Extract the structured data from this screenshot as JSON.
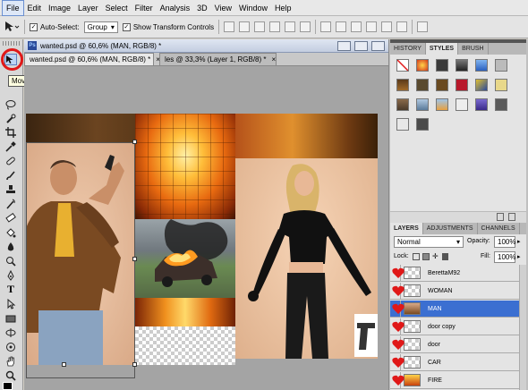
{
  "menu": [
    "File",
    "Edit",
    "Image",
    "Layer",
    "Select",
    "Filter",
    "Analysis",
    "3D",
    "View",
    "Window",
    "Help"
  ],
  "options_bar": {
    "auto_select_label": "Auto-Select:",
    "auto_select_value": "Group",
    "show_transform_label": "Show Transform Controls"
  },
  "document": {
    "window_title": "wanted.psd @ 60,6% (MAN, RGB/8) *",
    "tabs": [
      {
        "label": "wanted.psd @ 60,6% (MAN, RGB/8) *",
        "close": "×",
        "active": true
      },
      {
        "label": "les @ 33,3% (Layer 1, RGB/8) *",
        "close": "×",
        "active": false
      }
    ]
  },
  "tooltip": "Move Tool (V)",
  "style_panel": {
    "tabs": [
      "HISTORY",
      "STYLES",
      "BRUSH"
    ]
  },
  "layers_panel": {
    "tabs": [
      "LAYERS",
      "ADJUSTMENTS",
      "CHANNELS"
    ],
    "blend_mode": "Normal",
    "opacity_label": "Opacity:",
    "opacity_value": "100%",
    "lock_label": "Lock:",
    "fill_label": "Fill:",
    "fill_value": "100%",
    "layers": [
      {
        "name": "BerettaM92",
        "selected": false
      },
      {
        "name": "WOMAN",
        "selected": false
      },
      {
        "name": "MAN",
        "selected": true
      },
      {
        "name": "door copy",
        "selected": false
      },
      {
        "name": "door",
        "selected": false
      },
      {
        "name": "CAR",
        "selected": false
      },
      {
        "name": "FIRE",
        "selected": false
      }
    ]
  },
  "colors": {
    "accent_circle": "#e01818",
    "selected_layer": "#3b6fd1",
    "heart": "#e01818"
  }
}
